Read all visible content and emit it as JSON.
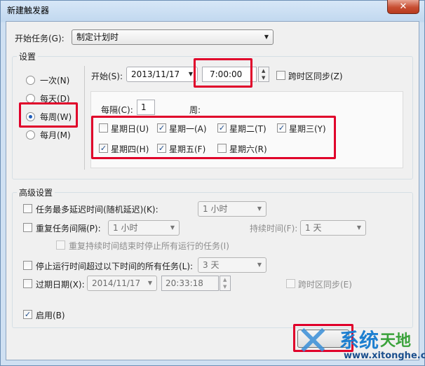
{
  "window": {
    "title": "新建触发器",
    "close_glyph": "✕"
  },
  "begin_task": {
    "label": "开始任务(G):",
    "value": "制定计划时"
  },
  "settings": {
    "title": "设置",
    "frequency": [
      {
        "label": "一次(N)",
        "selected": false
      },
      {
        "label": "每天(D)",
        "selected": false
      },
      {
        "label": "每周(W)",
        "selected": true
      },
      {
        "label": "每月(M)",
        "selected": false
      }
    ],
    "start_label": "开始(S):",
    "start_date": "2013/11/17",
    "start_time": "7:00:00",
    "sync_tz_label": "跨时区同步(Z)",
    "recur_label": "每隔(C):",
    "recur_value": "1",
    "week_label": "周:",
    "days": [
      {
        "label": "星期日(U)",
        "checked": false
      },
      {
        "label": "星期一(A)",
        "checked": true
      },
      {
        "label": "星期二(T)",
        "checked": true
      },
      {
        "label": "星期三(Y)",
        "checked": true
      },
      {
        "label": "星期四(H)",
        "checked": true
      },
      {
        "label": "星期五(F)",
        "checked": true
      },
      {
        "label": "星期六(R)",
        "checked": false
      }
    ]
  },
  "advanced": {
    "title": "高级设置",
    "delay": {
      "label": "任务最多延迟时间(随机延迟)(K):",
      "value": "1 小时",
      "checked": false
    },
    "repeat": {
      "label": "重复任务间隔(P):",
      "value": "1 小时",
      "checked": false,
      "duration_label": "持续时间(F):",
      "duration_value": "1 天"
    },
    "stop_running": {
      "label": "重复持续时间结束时停止所有运行的任务(I)"
    },
    "stop_over": {
      "label": "停止运行时间超过以下时间的所有任务(L):",
      "value": "3 天",
      "checked": false
    },
    "expire": {
      "label": "过期日期(X):",
      "date": "2014/11/17",
      "time": "20:33:18",
      "checked": false,
      "sync_label": "跨时区同步(E)"
    },
    "enabled": {
      "label": "启用(B)",
      "checked": true
    }
  },
  "watermark": {
    "brand_a": "系统",
    "brand_b": "天地",
    "url": "www.xitonghe.com"
  },
  "colors": {
    "highlight": "#e0002a",
    "accent": "#1f5dbb"
  }
}
